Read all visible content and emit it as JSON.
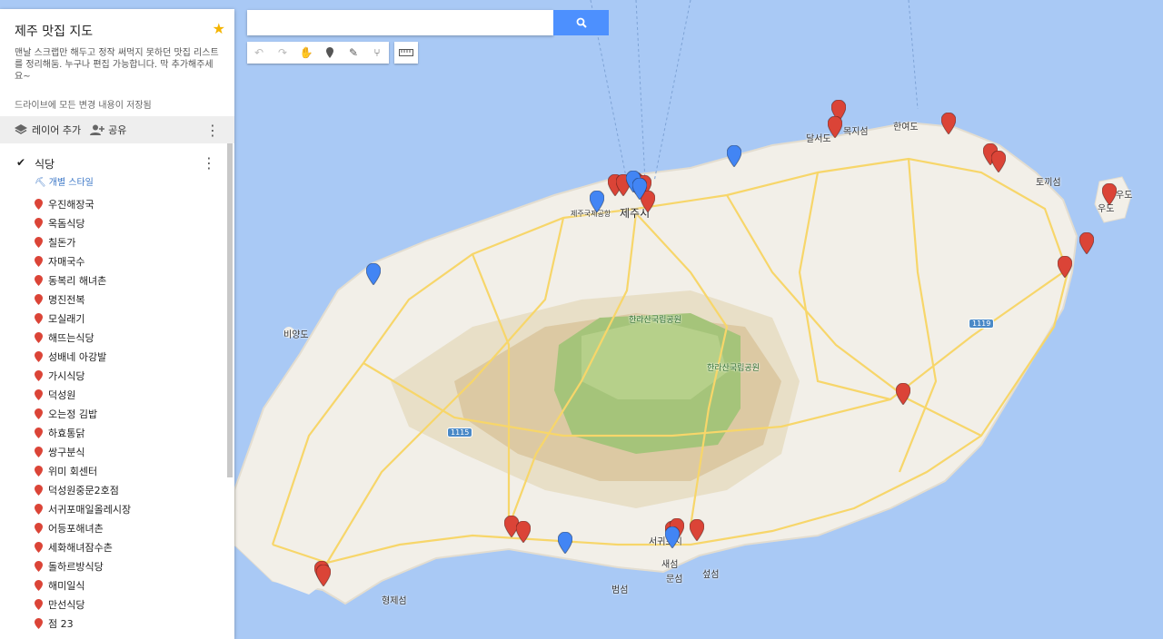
{
  "map": {
    "title": "제주 맛집 지도",
    "description": "맨날 스크랩만 해두고 정작 써먹지 못하던 맛집 리스트를 정리해둠. 누구나 편집 가능합니다. 막 추가해주세요~",
    "saved_status": "드라이브에 모든 변경 내용이 저장됨",
    "toolbar": {
      "add_layer": "레이어 추가",
      "share": "공유"
    },
    "layer": {
      "name": "식당",
      "style_link": "개별 스타일",
      "items": [
        "우진해장국",
        "옥돔식당",
        "칠돈가",
        "자매국수",
        "동복리 해녀촌",
        "명진전복",
        "모실래기",
        "해뜨는식당",
        "성배네 아강발",
        "가시식당",
        "덕성원",
        "오는정 김밥",
        "하효통닭",
        "쌍구분식",
        "위미 회센터",
        "덕성원중문2호점",
        "서귀포매일올레시장",
        "어등포해녀촌",
        "세화해녀잠수촌",
        "돌하르방식당",
        "해미일식",
        "만선식당",
        "점 23"
      ]
    }
  },
  "search": {
    "placeholder": "",
    "button_icon": "search-icon"
  },
  "tools": [
    "undo-icon",
    "redo-icon",
    "hand-icon",
    "marker-icon",
    "draw-line-icon",
    "directions-icon",
    "ruler-icon"
  ],
  "place_labels": [
    "제주시",
    "제주국제공항",
    "한라산국립공원",
    "한라산국립공원",
    "비양도",
    "달서도",
    "목지섬",
    "한여도",
    "토끼섬",
    "우도",
    "우도",
    "서귀포시",
    "새섬",
    "문섬",
    "섶섬",
    "범섬",
    "형제섬"
  ],
  "road_labels": [
    "1115",
    "1119"
  ],
  "colors": {
    "marker_red": "#db4437",
    "marker_blue": "#4285f4",
    "sea": "#a9c9f5",
    "land": "#f2efe8",
    "park_dark": "#a5c47a",
    "roads": "#f7d66a"
  }
}
